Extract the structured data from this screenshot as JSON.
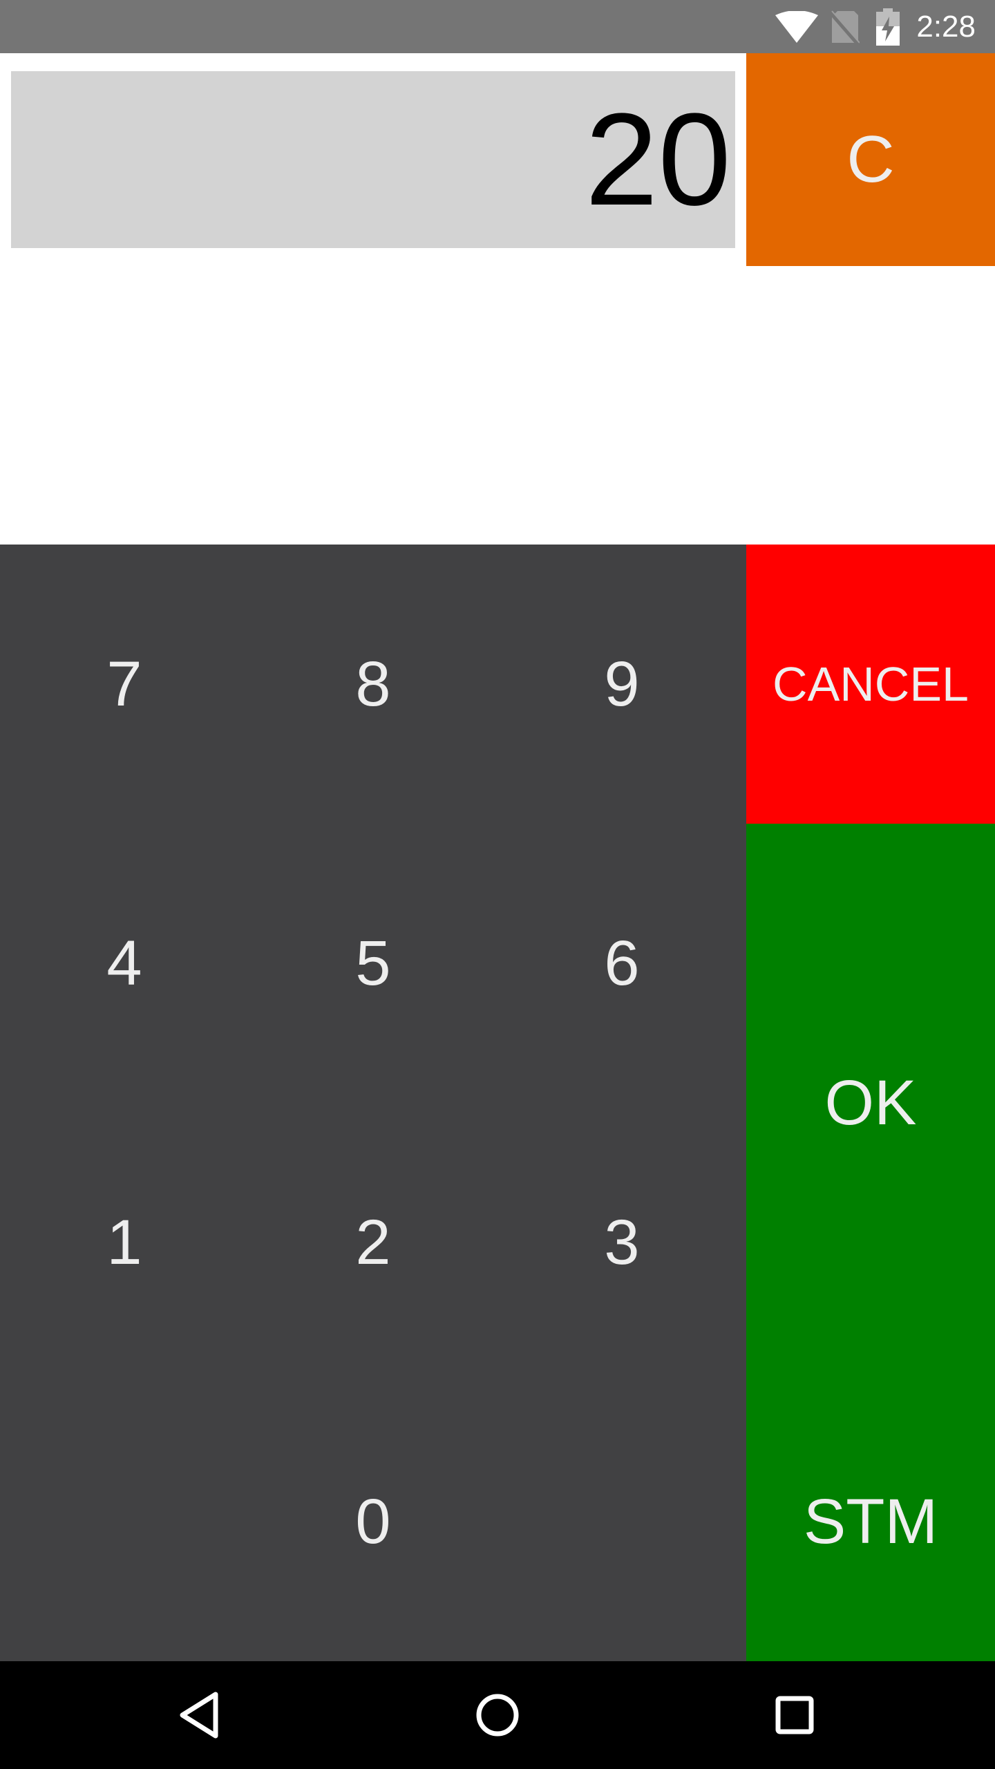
{
  "status_bar": {
    "time": "2:28",
    "icons": [
      "wifi-icon",
      "no-sim-icon",
      "battery-charging-icon"
    ],
    "background": "#757575"
  },
  "display": {
    "value": "20",
    "background": "#d3d3d3"
  },
  "clear_button": {
    "label": "C",
    "color": "#e36700"
  },
  "keypad": {
    "background": "#414143",
    "keys": [
      "7",
      "8",
      "9",
      "4",
      "5",
      "6",
      "1",
      "2",
      "3",
      "",
      "0",
      ""
    ]
  },
  "actions": {
    "cancel_label": "CANCEL",
    "cancel_color": "#ff0000",
    "ok_label": "OK",
    "ok_color": "#008000",
    "stm_label": "STM",
    "stm_color": "#008000"
  },
  "nav_bar": {
    "icons": [
      "back-icon",
      "home-icon",
      "recents-icon"
    ]
  }
}
